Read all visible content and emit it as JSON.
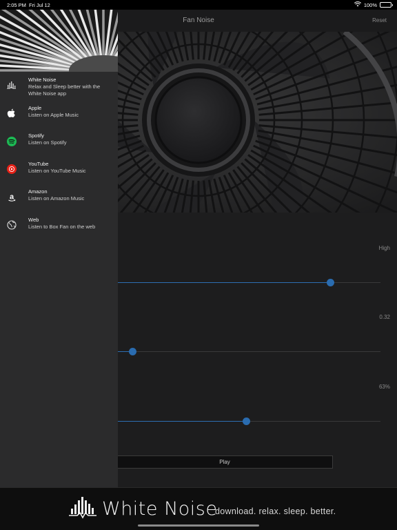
{
  "status": {
    "time": "2:05 PM",
    "date": "Fri Jul 12",
    "battery": "100%"
  },
  "nav": {
    "title": "Fan Noise",
    "reset": "Reset"
  },
  "controls": {
    "sliders": [
      {
        "name": "speed",
        "label": "High",
        "value": 0.81
      },
      {
        "name": "pitch",
        "label": "0.32",
        "value": 0.06
      },
      {
        "name": "volume",
        "label": "63%",
        "value": 0.49
      }
    ],
    "play": "Play"
  },
  "drawer": {
    "items": [
      {
        "title": "White Noise",
        "subtitle": "Relax and Sleep better with the White Noise app",
        "icon": "white-noise-icon"
      },
      {
        "title": "Apple",
        "subtitle": "Listen on Apple Music",
        "icon": "apple-icon"
      },
      {
        "title": "Spotify",
        "subtitle": "Listen on Spotify",
        "icon": "spotify-icon"
      },
      {
        "title": "YouTube",
        "subtitle": "Listen on YouTube Music",
        "icon": "youtube-icon"
      },
      {
        "title": "Amazon",
        "subtitle": "Listen on Amazon Music",
        "icon": "amazon-icon"
      },
      {
        "title": "Web",
        "subtitle": "Listen to Box Fan on the web",
        "icon": "globe-icon"
      }
    ]
  },
  "banner": {
    "brand": "White Noise",
    "tagline": "download. relax. sleep. better."
  },
  "colors": {
    "accent": "#2a6cb0",
    "spotify": "#1db954",
    "youtube": "#e62117"
  }
}
